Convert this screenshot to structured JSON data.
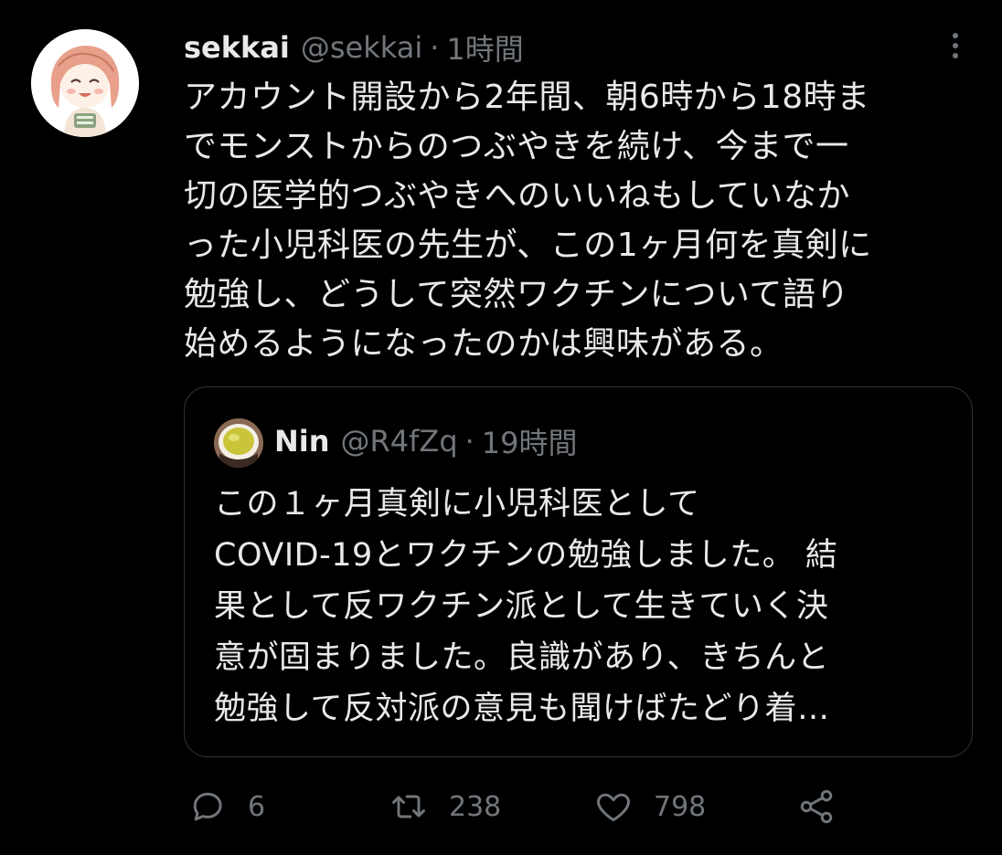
{
  "tweet": {
    "display_name": "sekkai",
    "handle": "@sekkai",
    "separator": "·",
    "time": "1時間",
    "text_lines": [
      "アカウント開設から2年間、朝6時から18時ま",
      "でモンストからのつぶやきを続け、今まで一",
      "切の医学的つぶやきへのいいねもしていなか",
      "った小児科医の先生が、この1ヶ月何を真剣に",
      "勉強し、どうして突然ワクチンについて語り",
      "始めるようになったのかは興味がある。"
    ]
  },
  "quote": {
    "display_name": "Nin",
    "handle": "@R4fZq",
    "separator": "·",
    "time": "19時間",
    "text_lines": [
      "この１ヶ月真剣に小児科医として",
      "COVID-19とワクチンの勉強しました。 結",
      "果として反ワクチン派として生きていく決",
      "意が固まりました。良識があり、きちんと",
      "勉強して反対派の意見も聞けばたどり着…"
    ]
  },
  "actions": {
    "reply_count": "6",
    "retweet_count": "238",
    "like_count": "798"
  },
  "icons": {
    "more": "more-vertical-icon",
    "reply": "reply-bubble-icon",
    "retweet": "retweet-icon",
    "like": "heart-icon",
    "share": "share-icon"
  },
  "colors": {
    "background": "#000000",
    "text": "#e7e9ea",
    "secondary": "#71767b",
    "border": "#2f3336"
  }
}
